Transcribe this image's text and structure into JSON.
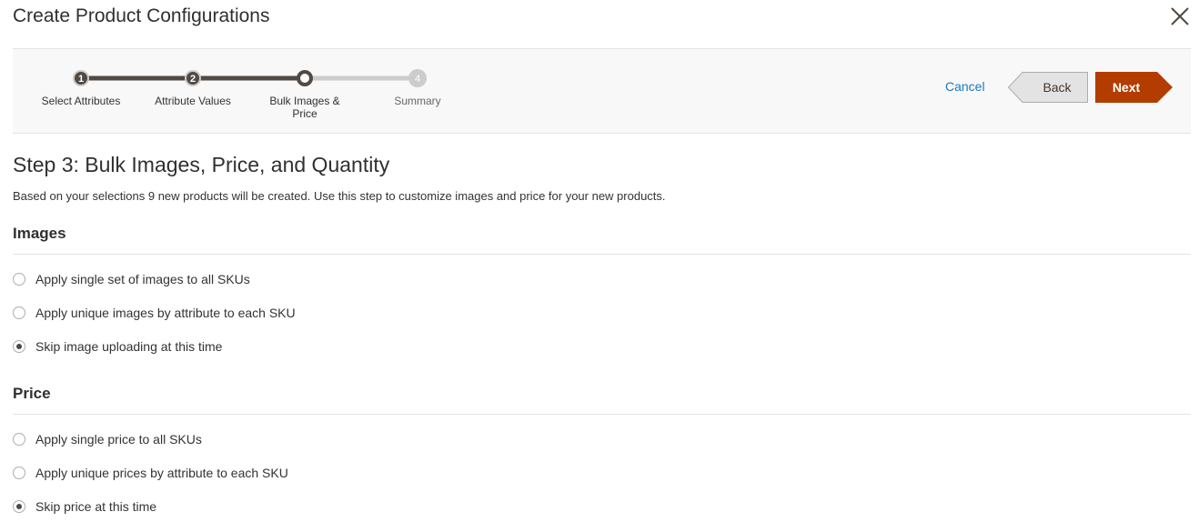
{
  "modal": {
    "title": "Create Product Configurations",
    "close_icon": "close-icon"
  },
  "wizard": {
    "steps": [
      {
        "number": "1",
        "label": "Select Attributes",
        "state": "completed"
      },
      {
        "number": "2",
        "label": "Attribute Values",
        "state": "completed"
      },
      {
        "number": "",
        "label_line1": "Bulk Images &",
        "label_line2": "Price",
        "state": "current"
      },
      {
        "number": "4",
        "label": "Summary",
        "state": "future"
      }
    ],
    "cancel_label": "Cancel",
    "back_label": "Back",
    "next_label": "Next",
    "colors": {
      "progress_done": "#514943",
      "progress_todo": "#cccccc",
      "next_bg": "#b33d00",
      "back_bg": "#e3e3e3",
      "link": "#1979c3"
    }
  },
  "content": {
    "heading": "Step 3: Bulk Images, Price, and Quantity",
    "description": "Based on your selections 9 new products will be created. Use this step to customize images and price for your new products."
  },
  "images_section": {
    "title": "Images",
    "options": [
      {
        "label": "Apply single set of images to all SKUs",
        "checked": false
      },
      {
        "label": "Apply unique images by attribute to each SKU",
        "checked": false
      },
      {
        "label": "Skip image uploading at this time",
        "checked": true
      }
    ]
  },
  "price_section": {
    "title": "Price",
    "options": [
      {
        "label": "Apply single price to all SKUs",
        "checked": false
      },
      {
        "label": "Apply unique prices by attribute to each SKU",
        "checked": false
      },
      {
        "label": "Skip price at this time",
        "checked": true
      }
    ]
  }
}
